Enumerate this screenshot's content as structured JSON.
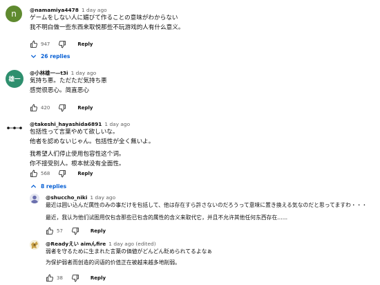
{
  "comments": [
    {
      "author": "@namamiya4478",
      "time": "1 day ago",
      "avatar_letter": "n",
      "lines": [
        "ゲームをしない人に媚びて作ることの意味がわからない",
        "我不明白做一些东西来取悦那些不玩游戏的人有什么意义。"
      ],
      "likes": "947",
      "reply_label": "Reply"
    },
    {
      "author": "@小林雄一—t3i",
      "time": "1 day ago",
      "avatar_letter": "雄一",
      "lines": [
        "気持ち悪。ただただ気持ち悪",
        "感觉很恶心。简直恶心"
      ],
      "likes": "420",
      "reply_label": "Reply"
    },
    {
      "author": "@takeshi_hayashida6891",
      "time": "1 day ago",
      "lines": [
        "包括性って言葉やめて欲しいな。",
        "他者を認めないじゃん。包括性が全く無いよ。",
        "",
        "我希望人们停止使用包容性这个词。",
        "你不接受别人。根本就没有全面性。"
      ],
      "likes": "568",
      "reply_label": "Reply"
    }
  ],
  "replies_toggle_1": "26 replies",
  "replies_toggle_2": "8 replies",
  "replies": [
    {
      "author": "@shuccho_niki",
      "time": "1 day ago",
      "lines": [
        "最近は囲い込んだ属性のみの事だけを包括して、他は存在すら許さないのだろうって意味に置き換える気なのだと思ってますわ・・・",
        "最近，我认为他们试图用仅包含那些已包含的属性的含义来取代它，并且不允许其他任何东西存在......"
      ],
      "likes": "57",
      "reply_label": "Reply"
    },
    {
      "author": "@Readyえい aimんfire",
      "time": "1 day ago (edited)",
      "lines": [
        "弱者を守るために生まれた言葉の価値がどんどん貶められてるよなぁ",
        "为保护弱者而创造的词语的价值正在被越来越多地削弱。"
      ],
      "likes": "38",
      "reply_label": "Reply"
    }
  ],
  "colors": {
    "avatar_n": "#5f8a2f",
    "avatar_kanji": "#2e8f6e",
    "link_blue": "#065fd4",
    "meta_gray": "#606060"
  }
}
